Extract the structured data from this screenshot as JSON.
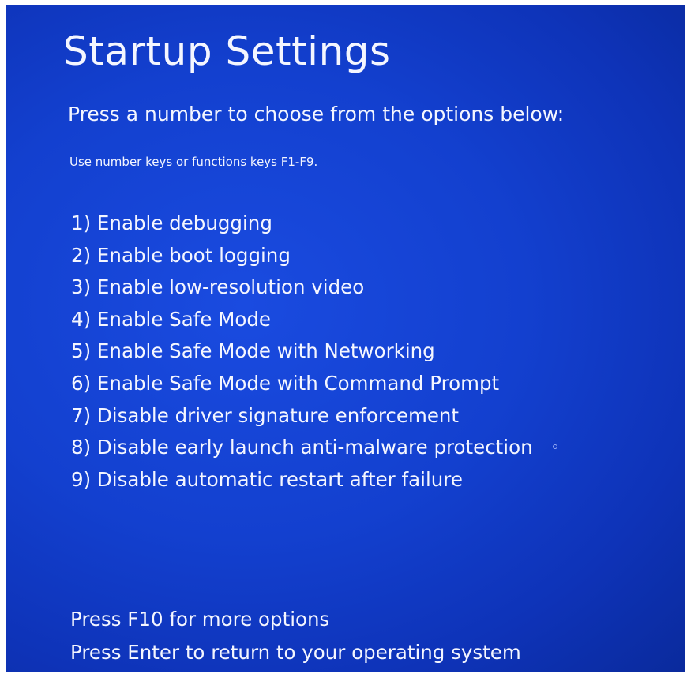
{
  "screen": {
    "title": "Startup Settings",
    "prompt": "Press a number to choose from the options below:",
    "hint": "Use number keys or functions keys F1-F9."
  },
  "options": [
    {
      "label": "1) Enable debugging"
    },
    {
      "label": "2) Enable boot logging"
    },
    {
      "label": "3) Enable low-resolution video"
    },
    {
      "label": "4) Enable Safe Mode"
    },
    {
      "label": "5) Enable Safe Mode with Networking"
    },
    {
      "label": "6) Enable Safe Mode with Command Prompt"
    },
    {
      "label": "7) Disable driver signature enforcement"
    },
    {
      "label": "8) Disable early launch anti-malware protection"
    },
    {
      "label": "9) Disable automatic restart after failure"
    }
  ],
  "footer": {
    "more_options": "Press F10 for more options",
    "return": "Press Enter to return to your operating system"
  },
  "colors": {
    "background": "#1340cf",
    "text": "#f4f6ff"
  },
  "icons": {
    "pointer": "mouse-pointer-icon"
  }
}
